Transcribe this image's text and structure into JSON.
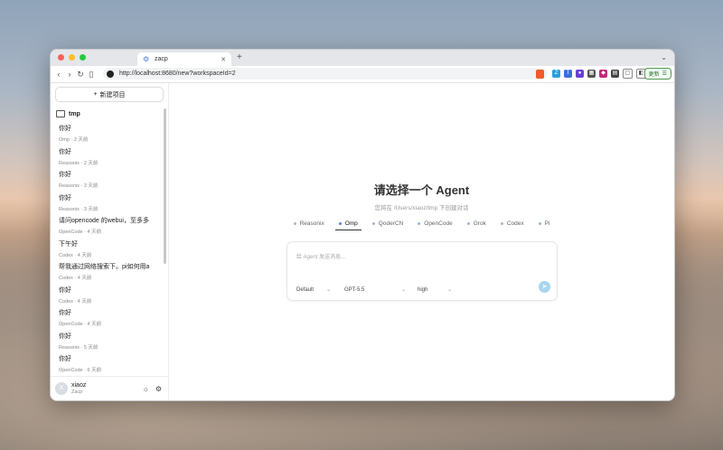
{
  "browser": {
    "tab_title": "zacp",
    "url": "http://localhost:8680/new?workspaceId=2",
    "update_label": "更新"
  },
  "sidebar": {
    "new_project_label": "新建项目",
    "folder_name": "tmp",
    "sessions": [
      {
        "title": "你好",
        "agent": "Omp",
        "time": "2 天前"
      },
      {
        "title": "你好",
        "agent": "Reasonix",
        "time": "2 天前"
      },
      {
        "title": "你好",
        "agent": "Reasonix",
        "time": "2 天前"
      },
      {
        "title": "你好",
        "agent": "Reasonix",
        "time": "3 天前"
      },
      {
        "title": "请问opencode 的webui，至多多...",
        "agent": "OpenCode",
        "time": "4 天前"
      },
      {
        "title": "下午好",
        "agent": "Codex",
        "time": "4 天前"
      },
      {
        "title": "帮我通过网络搜索下。pi如何用a...",
        "agent": "Codex",
        "time": "4 天前"
      },
      {
        "title": "你好",
        "agent": "Codex",
        "time": "4 天前"
      },
      {
        "title": "你好",
        "agent": "OpenCode",
        "time": "4 天前"
      },
      {
        "title": "你好",
        "agent": "Reasonix",
        "time": "5 天前"
      },
      {
        "title": "你好",
        "agent": "OpenCode",
        "time": "6 天前"
      }
    ],
    "user": {
      "initial": "X",
      "name": "xiaoz",
      "company": "Zacp"
    }
  },
  "main": {
    "title": "请选择一个 Agent",
    "subtitle": "您将在 /Users/xiaoz/tmp 下创建对话",
    "agents": [
      "Reasonix",
      "Omp",
      "QoderCN",
      "OpenCode",
      "Grok",
      "Codex",
      "Pi"
    ],
    "active_agent": "Omp",
    "input_placeholder": "给 Agent 发送消息...",
    "mode_value": "Default",
    "model_value": "GPT-5.5",
    "effort_value": "high"
  },
  "colors": {
    "accent": "#4c86e0",
    "send": "#a9d5f0"
  }
}
